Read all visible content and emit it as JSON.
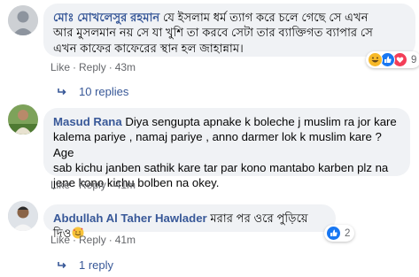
{
  "comments": [
    {
      "author": "মোঃ মোখলেসুর রহমান",
      "text_line1": " যে ইসলাম ধর্ম ত্যাগ করে চলে গেছে সে এখন",
      "text_line2": "আর মুসলমান নয় সে যা খুশি তা করবে সেটা তার ব্যাক্তিগত ব্যাপার সে",
      "text_line3": "এখন কাফের কাফেরের স্থান হল জাহান্নাম।",
      "like": "Like",
      "reply": "Reply",
      "time": "43m",
      "reaction_count": "9",
      "replies": "10 replies"
    },
    {
      "author": "Masud Rana",
      "text_line1": " Diya sengupta apnake k boleche j muslim ra jor kare",
      "text_line2": "kalema pariye , namaj pariye , anno darmer lok k muslim kare ? Age",
      "text_line3": "sab kichu janben sathik kare tar par kono mantabo karben plz na",
      "text_line4": "jene kono kichu bolben na okey.",
      "like": "Like",
      "reply": "Reply",
      "time": "41m"
    },
    {
      "author": "Abdullah Al Taher Hawlader",
      "text_line1": " মরার পর ওরে পুড়িয়ে দিও",
      "like": "Like",
      "reply": "Reply",
      "time": "41m",
      "reaction_count": "2",
      "replies": "1 reply"
    }
  ],
  "colors": {
    "link": "#385898",
    "bubble": "#f0f2f5",
    "meta": "#65676b",
    "like_blue": "#1877f2",
    "haha_yellow": "#f7b928"
  }
}
